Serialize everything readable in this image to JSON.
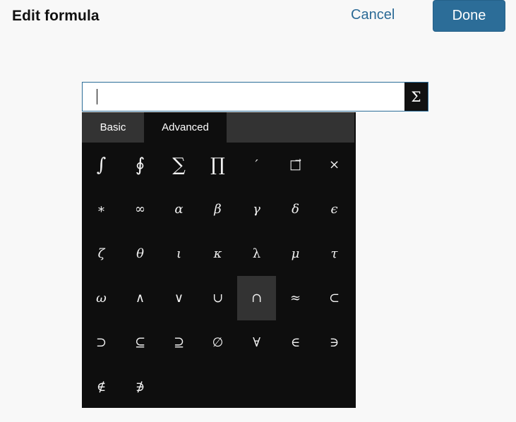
{
  "header": {
    "title": "Edit formula",
    "cancel_label": "Cancel",
    "done_label": "Done"
  },
  "formula": {
    "value": "",
    "toggle_symbol": "Σ"
  },
  "palette": {
    "tabs": [
      {
        "label": "Basic",
        "active": false
      },
      {
        "label": "Advanced",
        "active": true
      }
    ],
    "symbols": [
      {
        "char": "∫",
        "icon": "integral-icon"
      },
      {
        "char": "∮",
        "icon": "contour-integral-icon"
      },
      {
        "char": "∑",
        "icon": "summation-icon"
      },
      {
        "char": "∏",
        "icon": "product-icon"
      },
      {
        "char": "′",
        "icon": "prime-icon"
      },
      {
        "char": "□⃗",
        "icon": "vector-arrow-icon"
      },
      {
        "char": "×",
        "icon": "times-icon"
      },
      {
        "char": "∗",
        "icon": "asterisk-icon"
      },
      {
        "char": "∞",
        "icon": "infinity-icon"
      },
      {
        "char": "α",
        "icon": "alpha-icon"
      },
      {
        "char": "β",
        "icon": "beta-icon"
      },
      {
        "char": "γ",
        "icon": "gamma-icon"
      },
      {
        "char": "δ",
        "icon": "delta-icon"
      },
      {
        "char": "ϵ",
        "icon": "epsilon-icon"
      },
      {
        "char": "ζ",
        "icon": "zeta-icon"
      },
      {
        "char": "θ",
        "icon": "theta-icon"
      },
      {
        "char": "ι",
        "icon": "iota-icon"
      },
      {
        "char": "κ",
        "icon": "kappa-icon"
      },
      {
        "char": "λ",
        "icon": "lambda-icon"
      },
      {
        "char": "μ",
        "icon": "mu-icon"
      },
      {
        "char": "τ",
        "icon": "tau-icon"
      },
      {
        "char": "ω",
        "icon": "omega-icon"
      },
      {
        "char": "∧",
        "icon": "logical-and-icon"
      },
      {
        "char": "∨",
        "icon": "logical-or-icon"
      },
      {
        "char": "∪",
        "icon": "union-icon"
      },
      {
        "char": "∩",
        "icon": "intersection-icon",
        "highlighted": true
      },
      {
        "char": "≈",
        "icon": "approx-icon"
      },
      {
        "char": "⊂",
        "icon": "subset-icon"
      },
      {
        "char": "⊃",
        "icon": "superset-icon"
      },
      {
        "char": "⊆",
        "icon": "subset-eq-icon"
      },
      {
        "char": "⊇",
        "icon": "superset-eq-icon"
      },
      {
        "char": "∅",
        "icon": "empty-set-icon"
      },
      {
        "char": "∀",
        "icon": "for-all-icon"
      },
      {
        "char": "∈",
        "icon": "element-of-icon"
      },
      {
        "char": "∋",
        "icon": "contains-icon"
      },
      {
        "char": "∉",
        "icon": "not-element-of-icon"
      },
      {
        "char": "∌",
        "icon": "not-contains-icon"
      }
    ]
  }
}
